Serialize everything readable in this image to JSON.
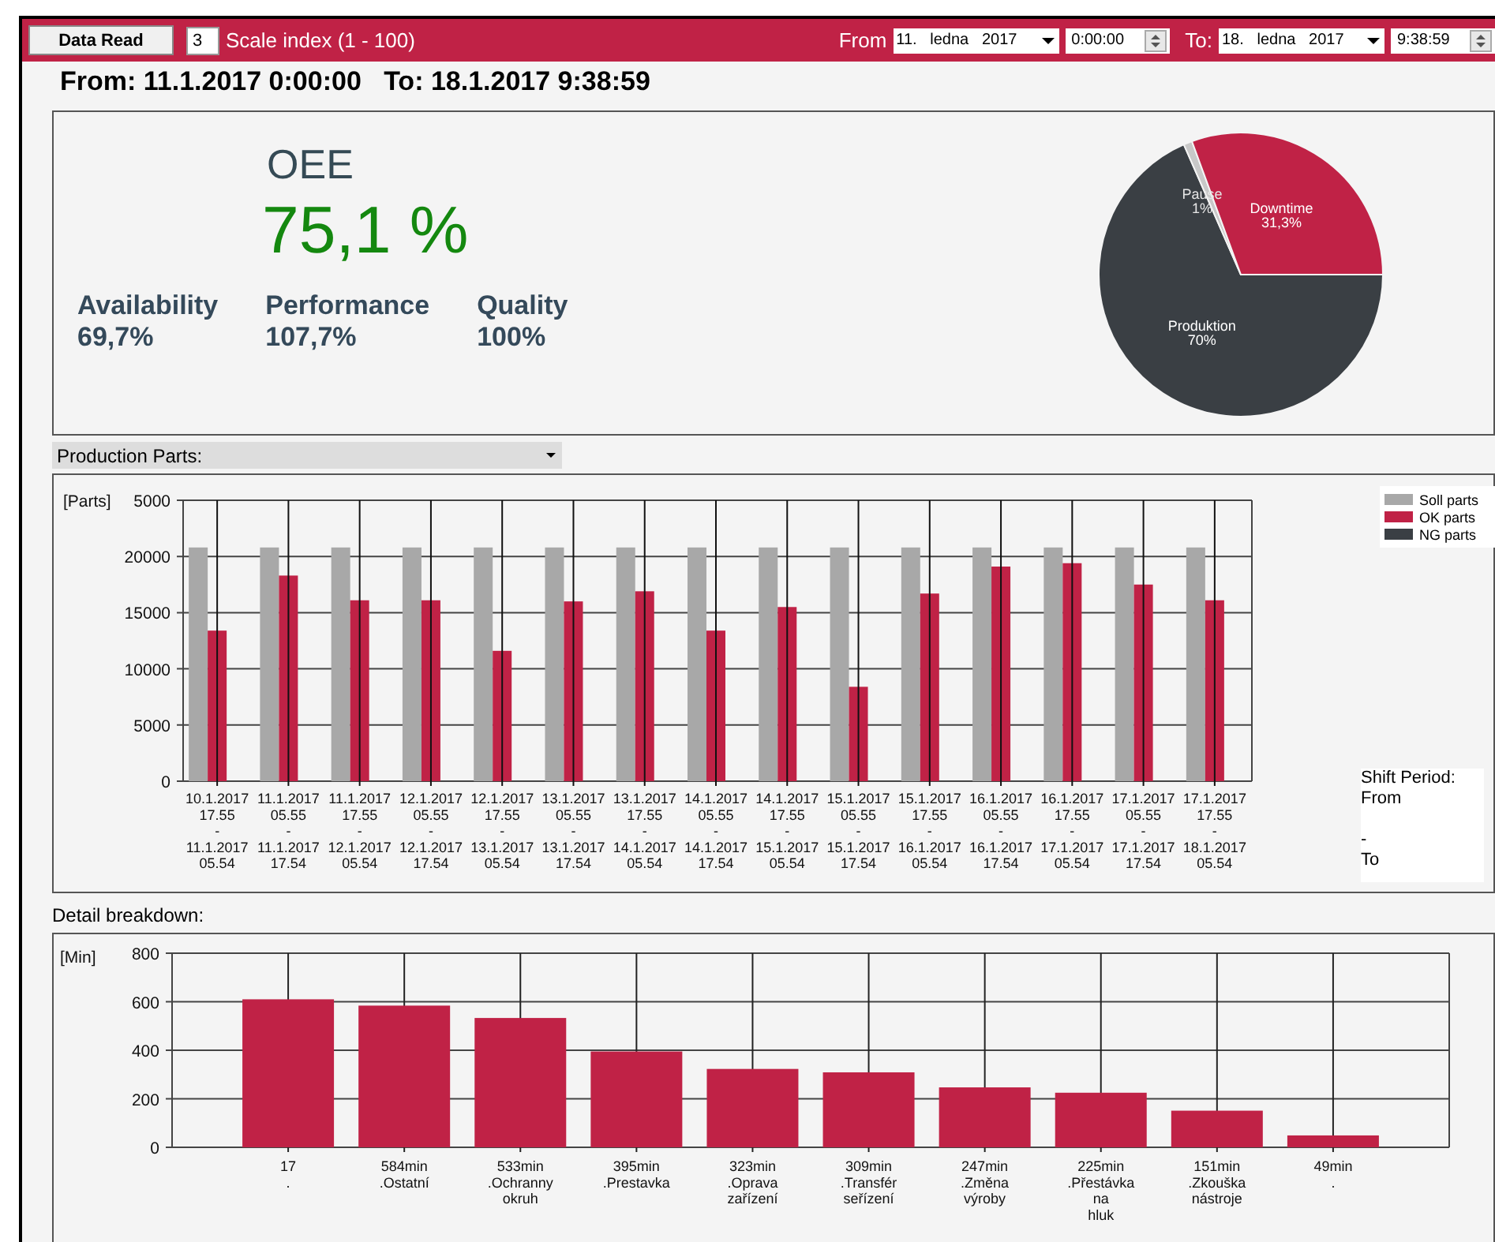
{
  "toolbar": {
    "read_button": "Data Read",
    "scale_value": "3",
    "scale_label": "Scale index (1 - 100)",
    "from_label": "From",
    "from_date": "11.   ledna   2017",
    "from_time": "0:00:00",
    "to_label": "To:",
    "to_date": "18.   ledna   2017",
    "to_time": "9:38:59"
  },
  "range_title": "From: 11.1.2017 0:00:00   To: 18.1.2017 9:38:59",
  "oee": {
    "title": "OEE",
    "value": "75,1 %",
    "metrics": [
      {
        "label": "Availability",
        "value": "69,7%"
      },
      {
        "label": "Performance",
        "value": "107,7%"
      },
      {
        "label": "Quality",
        "value": "100%"
      }
    ]
  },
  "pie": {
    "chart_data": {
      "type": "pie",
      "categories": [
        "Produktion",
        "Pause",
        "Downtime"
      ],
      "values": [
        70,
        1,
        31.3
      ],
      "colors": [
        "#3a3f44",
        "#c8c8c8",
        "#c02246"
      ],
      "value_labels": [
        "70%",
        "1%",
        "31,3%"
      ]
    }
  },
  "parts_selector": {
    "value": "Production Parts:"
  },
  "parts_chart": {
    "chart_data": {
      "type": "bar",
      "ylabel": "[Parts]",
      "categories": [
        "10.1.2017\n17.55\n-\n11.1.2017\n05.54",
        "11.1.2017\n05.55\n-\n11.1.2017\n17.54",
        "11.1.2017\n17.55\n-\n12.1.2017\n05.54",
        "12.1.2017\n05.55\n-\n12.1.2017\n17.54",
        "12.1.2017\n17.55\n-\n13.1.2017\n05.54",
        "13.1.2017\n05.55\n-\n13.1.2017\n17.54",
        "13.1.2017\n17.55\n-\n14.1.2017\n05.54",
        "14.1.2017\n05.55\n-\n14.1.2017\n17.54",
        "14.1.2017\n17.55\n-\n15.1.2017\n05.54",
        "15.1.2017\n05.55\n-\n15.1.2017\n17.54",
        "15.1.2017\n17.55\n-\n16.1.2017\n05.54",
        "16.1.2017\n05.55\n-\n16.1.2017\n17.54",
        "16.1.2017\n17.55\n-\n17.1.2017\n05.54",
        "17.1.2017\n05.55\n-\n17.1.2017\n17.54",
        "17.1.2017\n17.55\n-\n18.1.2017\n05.54"
      ],
      "series": [
        {
          "name": "Soll parts",
          "color": "#a8a8a8",
          "values": [
            20800,
            20800,
            20800,
            20800,
            20800,
            20800,
            20800,
            20800,
            20800,
            20800,
            20800,
            20800,
            20800,
            20800,
            20800
          ]
        },
        {
          "name": "OK parts",
          "color": "#c02246",
          "values": [
            13400,
            18300,
            16100,
            16100,
            11600,
            16000,
            16900,
            13400,
            15500,
            8400,
            16700,
            19100,
            19400,
            17500,
            16100
          ]
        },
        {
          "name": "NG parts",
          "color": "#3a3f44",
          "values": [
            0,
            0,
            0,
            0,
            0,
            0,
            0,
            0,
            0,
            0,
            0,
            0,
            0,
            0,
            0
          ]
        }
      ],
      "ylim": [
        0,
        25000
      ],
      "grid": true,
      "yticks": [
        0,
        5000,
        10000,
        15000,
        20000
      ]
    },
    "top_axis_text": "5000"
  },
  "shift_period": {
    "text": "Shift Period:\nFrom\n\n-\nTo"
  },
  "detail_label": "Detail breakdown:",
  "detail_chart": {
    "chart_data": {
      "type": "bar",
      "ylabel": "[Min]",
      "categories": [
        "17\n.",
        "584min\n.Ostatní",
        "533min\n.Ochranny\nokruh",
        "395min\n.Prestavka",
        "323min\n.Oprava\nzařízení",
        "309min\n.Transfér\nseřízení",
        "247min\n.Změna\nvýroby",
        "225min\n.Přestávka\nna\nhluk",
        "151min\n.Zkouška\nnástroje",
        "49min\n."
      ],
      "series": [
        {
          "color": "#c02246",
          "values": [
            610,
            584,
            533,
            395,
            323,
            309,
            247,
            225,
            151,
            49
          ]
        }
      ],
      "ylim": [
        0,
        800
      ],
      "grid": true,
      "yticks": [
        0,
        200,
        400,
        600,
        800
      ]
    }
  }
}
